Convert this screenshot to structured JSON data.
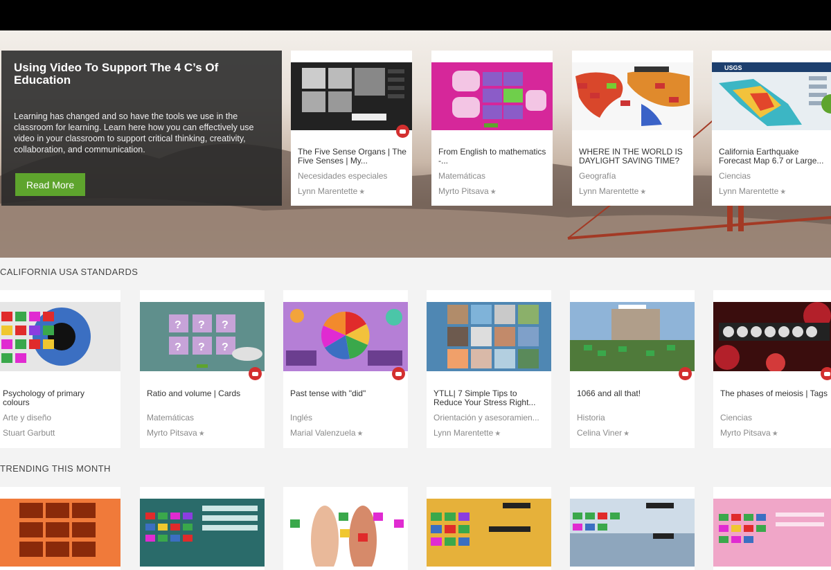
{
  "promo": {
    "title": "Using Video To Support The 4 C’s Of Education",
    "body": "Learning has changed and so have the tools we use in the classroom for learning. Learn here how you can effectively use video in your classroom to support critical thinking, creativity, collaboration, and communication.",
    "button": "Read More"
  },
  "hero_cards": [
    {
      "title": "The Five Sense Organs | The Five Senses | My...",
      "category": "Necesidades especiales",
      "author": "Lynn Marentette",
      "star": true,
      "video": true
    },
    {
      "title": "From English to mathematics -...",
      "category": "Matemáticas",
      "author": "Myrto Pitsava",
      "star": true,
      "video": false
    },
    {
      "title": "WHERE IN THE WORLD IS DAYLIGHT SAVING TIME?",
      "category": "Geografía",
      "author": "Lynn Marentette",
      "star": true,
      "video": false
    },
    {
      "title": "California Earthquake Forecast Map 6.7 or Large...",
      "category": "Ciencias",
      "author": "Lynn Marentette",
      "star": true,
      "video": false
    }
  ],
  "section1": {
    "title": "CALIFORNIA USA STANDARDS",
    "cards": [
      {
        "title": "Psychology of primary colours",
        "category": "Arte y diseño",
        "author": "Stuart Garbutt",
        "star": false,
        "video": false
      },
      {
        "title": "Ratio and volume | Cards",
        "category": "Matemáticas",
        "author": "Myrto Pitsava",
        "star": true,
        "video": true
      },
      {
        "title": "Past tense with \"did\"",
        "category": "Inglés",
        "author": "Marial Valenzuela",
        "star": true,
        "video": true
      },
      {
        "title": "YTLL| 7 Simple Tips to Reduce Your Stress Right...",
        "category": "Orientación y asesoramien...",
        "author": "Lynn Marentette",
        "star": true,
        "video": false
      },
      {
        "title": "1066 and all that!",
        "category": "Historia",
        "author": "Celina Viner",
        "star": true,
        "video": true
      },
      {
        "title": "The phases of meiosis | Tags",
        "category": "Ciencias",
        "author": "Myrto Pitsava",
        "star": true,
        "video": true
      }
    ]
  },
  "section2": {
    "title": "TRENDING THIS MONTH"
  },
  "thumb_text": {
    "senses": "THE FIVE SENSE ORGANS",
    "quiz": "?",
    "usgs": "USGS"
  },
  "colors": {
    "accent_green": "#5ea42d",
    "video_red": "#d32f2f"
  }
}
